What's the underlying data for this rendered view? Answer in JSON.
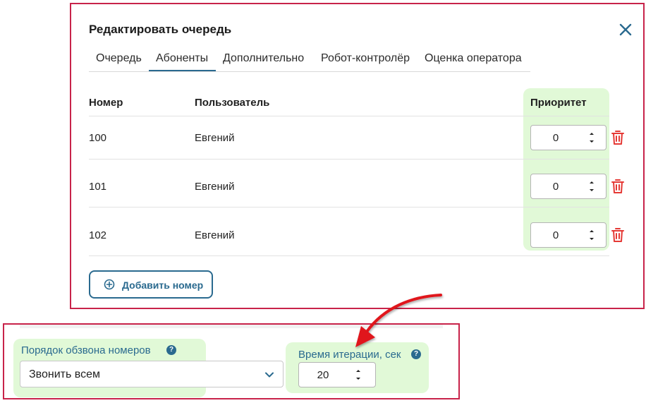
{
  "dialog": {
    "title": "Редактировать очередь",
    "tabs": [
      {
        "label": "Очередь"
      },
      {
        "label": "Абоненты"
      },
      {
        "label": "Дополнительно"
      },
      {
        "label": "Робот-контролёр"
      },
      {
        "label": "Оценка оператора"
      }
    ],
    "active_tab": "Абоненты",
    "table": {
      "headers": {
        "number": "Номер",
        "user": "Пользователь",
        "priority": "Приоритет"
      },
      "rows": [
        {
          "number": "100",
          "user": "Евгений",
          "priority": "0"
        },
        {
          "number": "101",
          "user": "Евгений",
          "priority": "0"
        },
        {
          "number": "102",
          "user": "Евгений",
          "priority": "0"
        }
      ]
    },
    "add_button_label": "Добавить номер"
  },
  "settings": {
    "call_order": {
      "label": "Порядок обзвона номеров",
      "help": "?",
      "value": "Звонить всем"
    },
    "iteration_time": {
      "label": "Время итерации, сек",
      "help": "?",
      "value": "20"
    }
  },
  "colors": {
    "accent": "#2a6a8f",
    "frame": "#c8234a",
    "highlight": "#e1f9d7",
    "delete": "#e53935"
  }
}
